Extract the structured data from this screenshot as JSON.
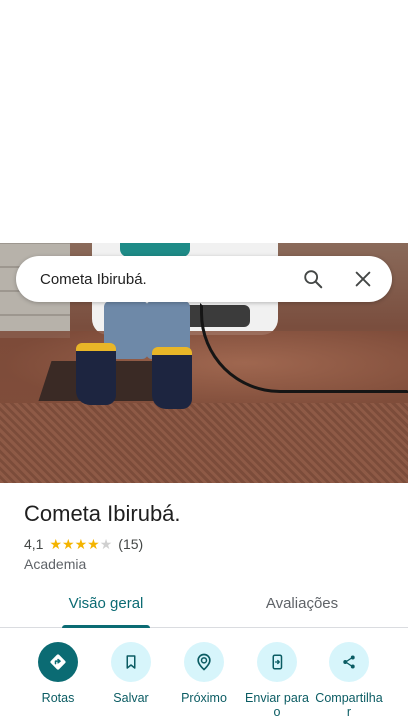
{
  "search": {
    "query": "Cometa Ibirubá."
  },
  "place": {
    "name": "Cometa Ibirubá.",
    "rating": "4,1",
    "stars": 4.1,
    "review_count": "(15)",
    "category": "Academia"
  },
  "tabs": [
    {
      "label": "Visão geral",
      "active": true
    },
    {
      "label": "Avaliações",
      "active": false
    }
  ],
  "actions": [
    {
      "label": "Rotas",
      "icon": "directions-icon"
    },
    {
      "label": "Salvar",
      "icon": "bookmark-icon"
    },
    {
      "label": "Próximo",
      "icon": "nearby-icon"
    },
    {
      "label": "Enviar para o",
      "icon": "send-to-phone-icon"
    },
    {
      "label": "Compartilha r",
      "icon": "share-icon"
    }
  ],
  "colors": {
    "accent": "#0b6b73",
    "action_bg": "#d7f5fb",
    "star": "#f4b400"
  }
}
